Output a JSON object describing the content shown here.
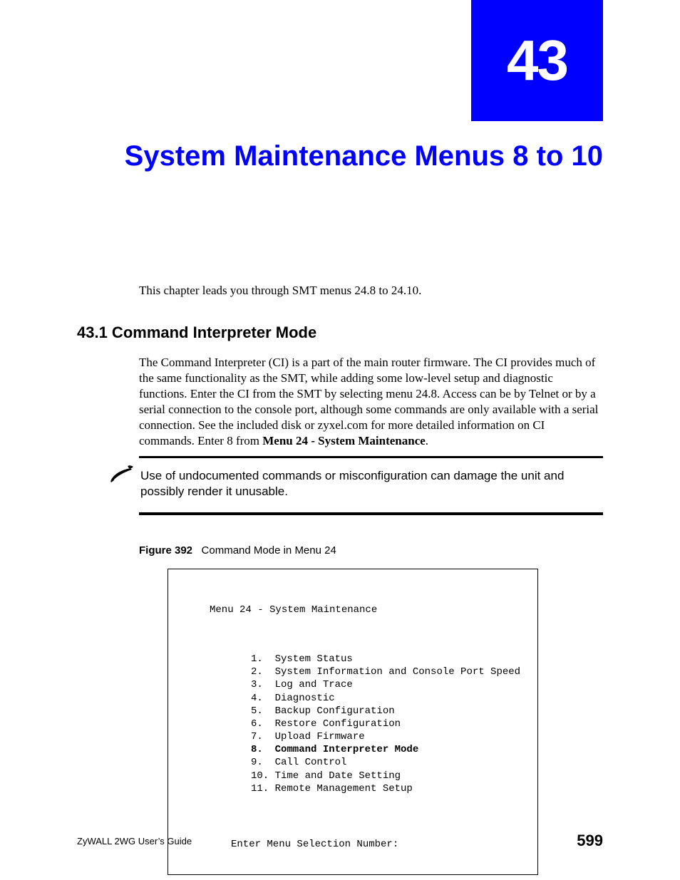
{
  "chapter": {
    "number": "43",
    "title": "System Maintenance Menus 8 to 10"
  },
  "intro": "This chapter leads you through SMT menus 24.8 to 24.10.",
  "section": {
    "number_title": "43.1  Command Interpreter Mode",
    "body_before": "The Command Interpreter (CI) is a part of the main router firmware. The CI provides much of the same functionality as the SMT, while adding some low-level setup and diagnostic functions. Enter the CI from the SMT by selecting menu 24.8. Access can be by Telnet or by a serial connection to the console port, although some commands are only available with a serial connection. See the included disk or zyxel.com for more detailed information on CI commands. Enter 8 from ",
    "menu_ref": "Menu 24 - System Maintenance",
    "body_after": "."
  },
  "note": {
    "text": "Use of undocumented commands or misconfiguration can damage the unit and possibly render it unusable."
  },
  "figure": {
    "label": "Figure 392",
    "caption": "Command Mode in Menu 24"
  },
  "terminal": {
    "title": "Menu 24 - System Maintenance",
    "items": [
      "1.  System Status",
      "2.  System Information and Console Port Speed",
      "3.  Log and Trace",
      "4.  Diagnostic",
      "5.  Backup Configuration",
      "6.  Restore Configuration",
      "7.  Upload Firmware",
      "8.  Command Interpreter Mode",
      "9.  Call Control",
      "10. Time and Date Setting",
      "11. Remote Management Setup"
    ],
    "bold_index": 7,
    "prompt": "Enter Menu Selection Number:"
  },
  "footer": {
    "guide": "ZyWALL 2WG User’s Guide",
    "page": "599"
  }
}
